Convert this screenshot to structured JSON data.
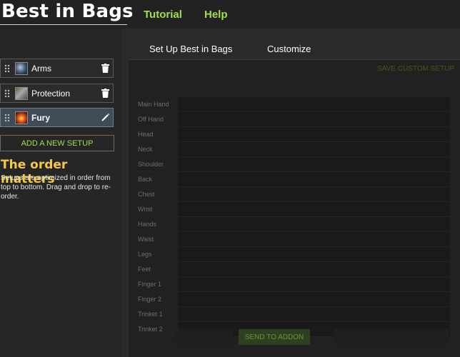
{
  "header": {
    "logo": "Best in Bags",
    "nav": [
      {
        "label": "Tutorial"
      },
      {
        "label": "Help"
      }
    ]
  },
  "sidebar": {
    "setups": [
      {
        "name": "Arms",
        "action": "trash-icon",
        "active": false
      },
      {
        "name": "Protection",
        "action": "trash-icon",
        "active": false
      },
      {
        "name": "Fury",
        "action": "pencil-icon",
        "active": true
      }
    ],
    "add_button": "ADD A NEW SETUP",
    "order_title": "The order matters",
    "order_desc": "Setups are optimized in order from top to bottom. Drag and drop to re-order."
  },
  "main": {
    "tabs": [
      {
        "label": "Set Up Best in Bags"
      },
      {
        "label": "Customize"
      }
    ],
    "save_custom": "SAVE CUSTOM SETUP",
    "slots": [
      "Main Hand",
      "Off Hand",
      "Head",
      "Neck",
      "Shoulder",
      "Back",
      "Chest",
      "Wrist",
      "Hands",
      "Waist",
      "Legs",
      "Feet",
      "Finger 1",
      "Finger 2",
      "Trinket 1",
      "Trinket 2"
    ],
    "send_button": "SEND TO ADDON"
  },
  "colors": {
    "accent_green": "#9ee04a",
    "title_gold": "#f5c842",
    "active_setup": "#3f4c57"
  }
}
